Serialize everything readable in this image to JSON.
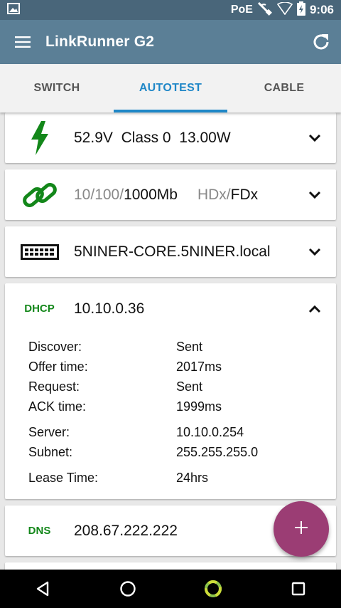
{
  "status_bar": {
    "poe_label": "PoE",
    "time": "9:06"
  },
  "app_bar": {
    "title": "LinkRunner G2",
    "bg_color": "#5b7f96"
  },
  "tabs": [
    {
      "label": "SWITCH",
      "active": false
    },
    {
      "label": "AUTOTEST",
      "active": true
    },
    {
      "label": "CABLE",
      "active": false
    }
  ],
  "cards": {
    "poe": {
      "icon": "lightning-bolt-icon",
      "voltage": "52.9V",
      "class": "Class 0",
      "power": "13.00W"
    },
    "link": {
      "icon": "chain-link-icon",
      "speeds_muted": "10/100/",
      "speed_active": "1000Mb",
      "duplex_muted": "HDx/",
      "duplex_active": "FDx"
    },
    "switch": {
      "icon": "keyboard-switch-icon",
      "name": "5NINER-CORE.5NINER.local"
    },
    "dhcp": {
      "icon_label": "DHCP",
      "address": "10.10.0.36",
      "rows": [
        {
          "key": "Discover:",
          "value": "Sent"
        },
        {
          "key": "Offer time:",
          "value": "2017ms"
        },
        {
          "key": "Request:",
          "value": "Sent"
        },
        {
          "key": "ACK time:",
          "value": "1999ms"
        }
      ],
      "rows2": [
        {
          "key": "Server:",
          "value": "10.10.0.254"
        },
        {
          "key": "Subnet:",
          "value": "255.255.255.0"
        }
      ],
      "rows3": [
        {
          "key": "Lease Time:",
          "value": "24hrs"
        }
      ]
    },
    "dns": {
      "icon_label": "DNS",
      "address": "208.67.222.222"
    }
  },
  "fab": {
    "icon": "plus-icon",
    "color": "#9b3d74"
  },
  "colors": {
    "accent": "#1f87c7",
    "green": "#13871a"
  }
}
